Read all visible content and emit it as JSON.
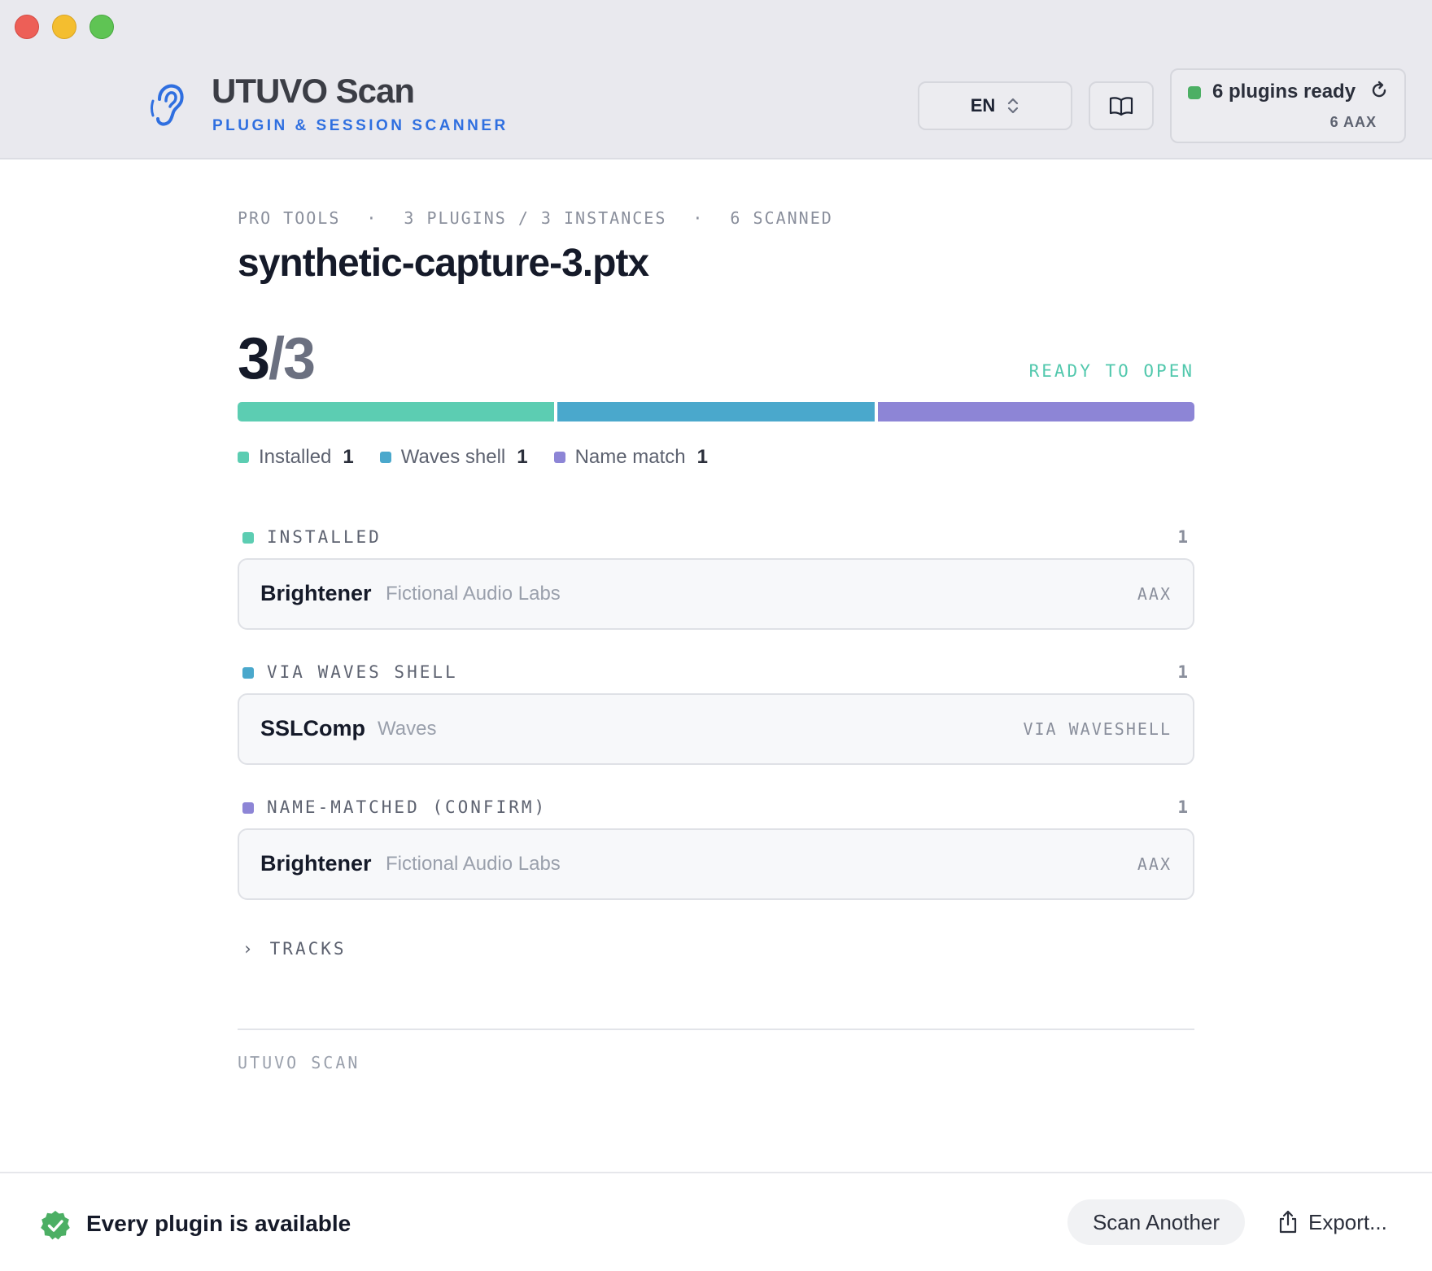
{
  "app": {
    "title": "UTUVO Scan",
    "subtitle": "PLUGIN & SESSION SCANNER",
    "icon": "ear-icon",
    "language": "EN",
    "status": {
      "label": "6 plugins ready",
      "sub": "6 AAX",
      "color": "#4caf64"
    }
  },
  "session": {
    "meta": [
      "PRO TOOLS",
      "3 PLUGINS / 3 INSTANCES",
      "6 SCANNED"
    ],
    "meta_separator": "·",
    "file_name": "synthetic-capture-3.ptx",
    "score_found": "3",
    "score_sep_total": "/3",
    "ready_label": "READY TO OPEN",
    "ready_color": "#52c8ad"
  },
  "breakdown": {
    "total": 3,
    "segments": [
      {
        "label": "Installed",
        "count": 1,
        "color": "#5ccdb2"
      },
      {
        "label": "Waves shell",
        "count": 1,
        "color": "#4aa8cc"
      },
      {
        "label": "Name match",
        "count": 1,
        "color": "#8d85d6"
      }
    ]
  },
  "sections": [
    {
      "label": "INSTALLED",
      "count": "1",
      "color": "#5ccdb2",
      "items": [
        {
          "name": "Brightener",
          "vendor": "Fictional Audio Labs",
          "format": "AAX"
        }
      ]
    },
    {
      "label": "VIA WAVES SHELL",
      "count": "1",
      "color": "#4aa8cc",
      "items": [
        {
          "name": "SSLComp",
          "vendor": "Waves",
          "format": "VIA WAVESHELL"
        }
      ]
    },
    {
      "label": "NAME-MATCHED (CONFIRM)",
      "count": "1",
      "color": "#8d85d6",
      "items": [
        {
          "name": "Brightener",
          "vendor": "Fictional Audio Labs",
          "format": "AAX"
        }
      ]
    }
  ],
  "tracks": {
    "chevron": "›",
    "label": "TRACKS"
  },
  "footer": {
    "brand": "UTUVO SCAN"
  },
  "bottom": {
    "message": "Every plugin is available",
    "message_icon": "check-badge-icon",
    "scan_button": "Scan Another",
    "export_button": "Export..."
  }
}
